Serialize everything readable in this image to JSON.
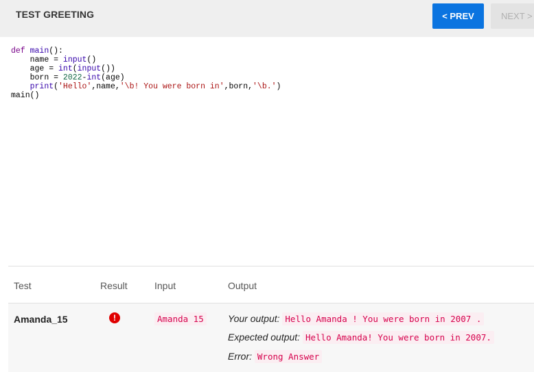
{
  "header": {
    "title": "TEST GREETING",
    "prev_label": "< PREV",
    "next_label": "NEXT >"
  },
  "code": {
    "lines": [
      "def main():",
      "    name = input()",
      "    age = int(input())",
      "    born = 2022-int(age)",
      "    print('Hello',name,'\\b! You were born in',born,'\\b.')",
      "main()"
    ],
    "tokens": {
      "def": "def",
      "main": "main",
      "paren_colon": "():",
      "indent": "    ",
      "name_eq": "name = ",
      "input_fn": "input",
      "parens": "()",
      "age_eq": "age = ",
      "int_fn": "int",
      "open": "(",
      "close2": "())",
      "born_eq": "born = ",
      "year": "2022",
      "dash": "-",
      "age_close": "(age)",
      "print_fn": "print",
      "s_hello": "'Hello'",
      "comma_name": ",name,",
      "s_born": "'\\b! You were born in'",
      "comma_born": ",born,",
      "s_dot": "'\\b.'",
      "close1": ")",
      "main_call": "main()"
    }
  },
  "results_table": {
    "headers": [
      "Test",
      "Result",
      "Input",
      "Output"
    ],
    "rows": [
      {
        "test": "Amanda_15",
        "result_icon": "error-icon",
        "input": "Amanda 15",
        "your_output_label": "Your output:",
        "your_output": "Hello Amanda ! You were born in 2007 .",
        "expected_output_label": "Expected output:",
        "expected_output": "Hello Amanda! You were born in 2007.",
        "error_label": "Error:",
        "error": "Wrong Answer"
      }
    ]
  },
  "colors": {
    "primary_button": "#0b74e0",
    "error": "#e00000",
    "code_string": "#aa1111",
    "code_keyword": "#770088",
    "output_text": "#d6004c"
  }
}
